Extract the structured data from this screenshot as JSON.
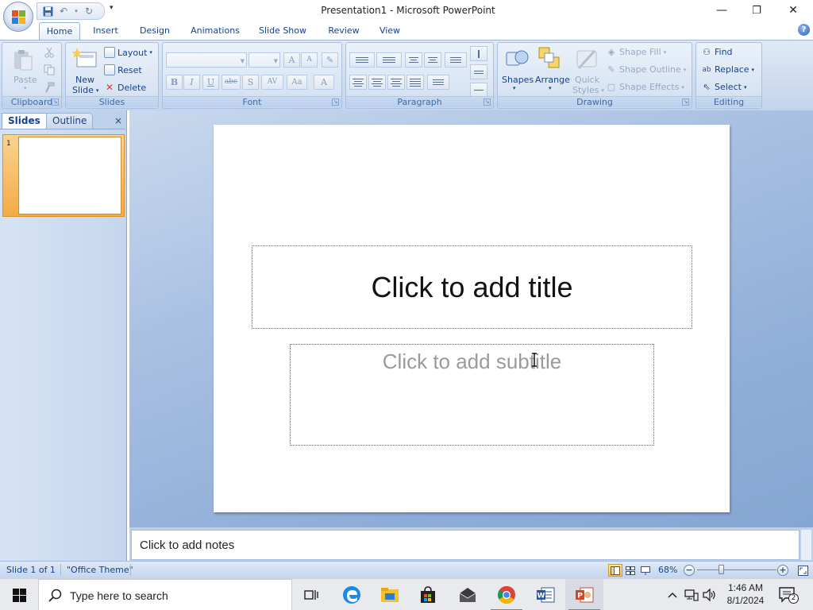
{
  "window": {
    "title": "Presentation1 - Microsoft PowerPoint",
    "minimize": "—",
    "maximize": "❐",
    "close": "✕"
  },
  "tabs": [
    {
      "label": "Home",
      "active": true
    },
    {
      "label": "Insert"
    },
    {
      "label": "Design"
    },
    {
      "label": "Animations"
    },
    {
      "label": "Slide Show"
    },
    {
      "label": "Review"
    },
    {
      "label": "View"
    }
  ],
  "help": "?",
  "ribbon": {
    "clipboard": {
      "label": "Clipboard",
      "paste": "Paste"
    },
    "slides": {
      "label": "Slides",
      "new_slide": "New",
      "new_slide_2": "Slide",
      "layout": "Layout",
      "reset": "Reset",
      "delete": "Delete"
    },
    "font": {
      "label": "Font",
      "bold": "B",
      "italic": "I",
      "underline": "U",
      "strike": "abc",
      "shadow": "S",
      "spacing": "AV",
      "case": "Aa",
      "color": "A",
      "grow": "A",
      "shrink": "A"
    },
    "paragraph": {
      "label": "Paragraph"
    },
    "drawing": {
      "label": "Drawing",
      "shapes": "Shapes",
      "arrange": "Arrange",
      "quick_styles": "Quick",
      "quick_styles_2": "Styles",
      "shape_fill": "Shape Fill",
      "shape_outline": "Shape Outline",
      "shape_effects": "Shape Effects"
    },
    "editing": {
      "label": "Editing",
      "find": "Find",
      "replace": "Replace",
      "select": "Select"
    }
  },
  "panel": {
    "tab_slides": "Slides",
    "tab_outline": "Outline",
    "close": "×",
    "slide_number": "1"
  },
  "slide": {
    "title_placeholder": "Click to add title",
    "subtitle_placeholder": "Click to add subtitle"
  },
  "notes": {
    "placeholder": "Click to add notes"
  },
  "status": {
    "slide_info": "Slide 1 of 1",
    "theme": "\"Office Theme\"",
    "zoom": "68%",
    "zoom_level": 0.68
  },
  "taskbar": {
    "search_placeholder": "Type here to search",
    "time": "1:46 AM",
    "date": "8/1/2024",
    "notifications": "2"
  }
}
